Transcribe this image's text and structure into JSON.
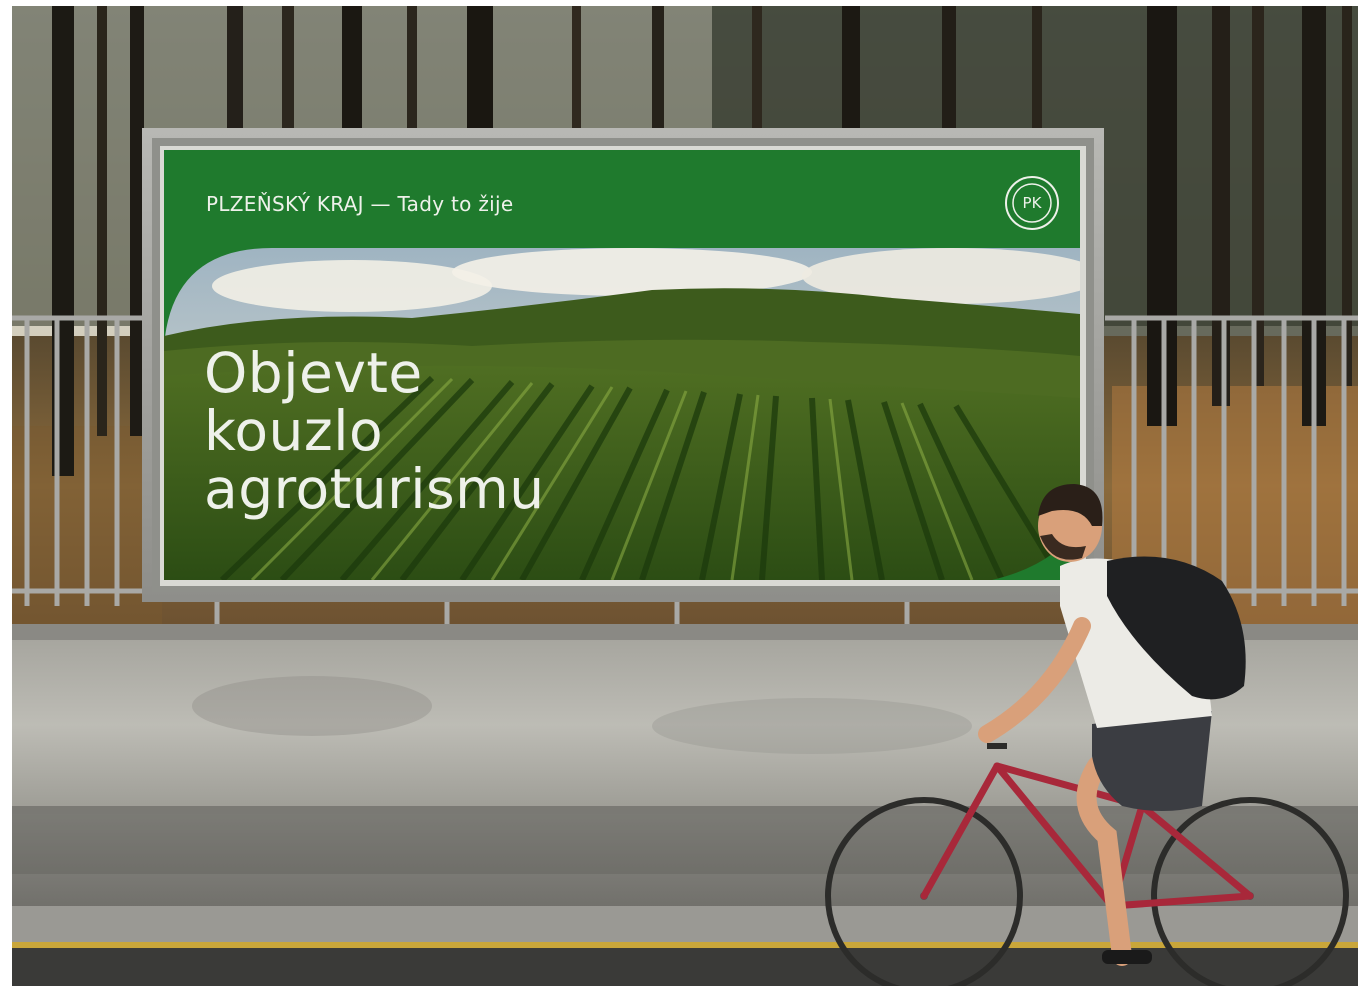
{
  "billboard": {
    "header": "PLZEŇSKÝ KRAJ — Tady to žije",
    "headline": [
      "Objevte",
      "kouzlo",
      "agroturismu"
    ],
    "logo": "PK",
    "brand_color": "#1f7a2d"
  },
  "scene": {
    "icons": [
      "forest-background",
      "fence",
      "concrete-wall",
      "road",
      "cyclist"
    ]
  }
}
